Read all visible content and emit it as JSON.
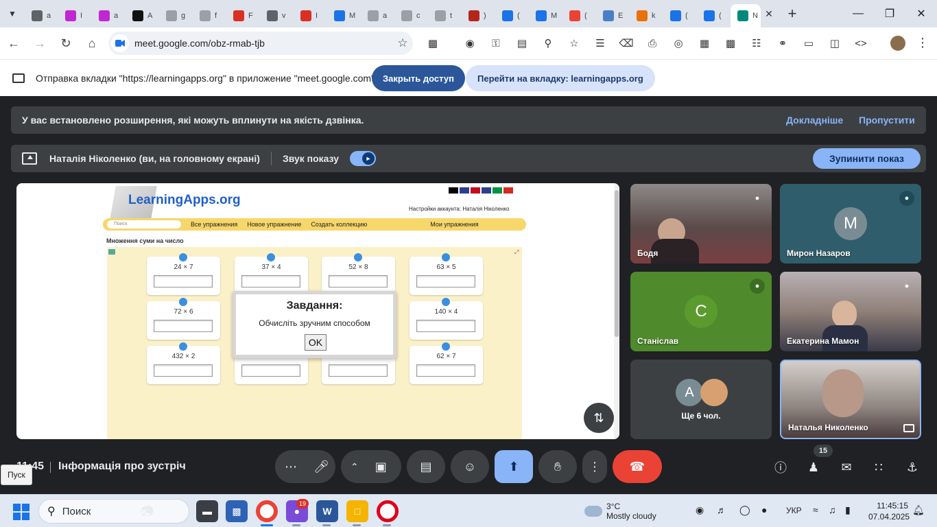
{
  "browser": {
    "tabs": [
      {
        "title": "a",
        "color": "#5f6368"
      },
      {
        "title": "I",
        "color": "#c026d3"
      },
      {
        "title": "a",
        "color": "#c026d3"
      },
      {
        "title": "A",
        "color": "#111111"
      },
      {
        "title": "g",
        "color": "#9aa0a6"
      },
      {
        "title": "f",
        "color": "#9aa0a6"
      },
      {
        "title": "F",
        "color": "#d93025"
      },
      {
        "title": "v",
        "color": "#5f6368"
      },
      {
        "title": "I",
        "color": "#d93025"
      },
      {
        "title": "M",
        "color": "#1a73e8"
      },
      {
        "title": "a",
        "color": "#9aa0a6"
      },
      {
        "title": "c",
        "color": "#9aa0a6"
      },
      {
        "title": "t",
        "color": "#9aa0a6"
      },
      {
        "title": ")",
        "color": "#b3261e"
      },
      {
        "title": "(",
        "color": "#1a73e8"
      },
      {
        "title": "M",
        "color": "#1a73e8"
      },
      {
        "title": "(",
        "color": "#ea4335"
      },
      {
        "title": "E",
        "color": "#4a7fc7"
      },
      {
        "title": "k",
        "color": "#e8710a"
      },
      {
        "title": "(",
        "color": "#1a73e8"
      },
      {
        "title": "(",
        "color": "#1a73e8"
      },
      {
        "title": "N",
        "color": "#00897b"
      }
    ],
    "url": "meet.google.com/obz-rmab-tjb"
  },
  "sharebar": {
    "text": "Отправка вкладки \"https://learningapps.org\" в приложение \"meet.google.com\"...",
    "stop_access": "Закрыть доступ",
    "goto_tab": "Перейти на вкладку: learningapps.org"
  },
  "warning": {
    "text": "У вас встановлено розширення, які можуть вплинути на якість дзвінка.",
    "details": "Докладніше",
    "skip": "Пропустити"
  },
  "presenting": {
    "text": "Наталія Ніколенко (ви, на головному екрані)",
    "sound_label": "Звук показу",
    "sound_on": true,
    "stop": "Зупинити показ"
  },
  "learningapps": {
    "logo": "LearningApps.org",
    "account": "Настройки аккаунта: Наталія Ніколенко",
    "search_placeholder": "Поиск",
    "nav": [
      "Все упражнения",
      "Новое упражнение",
      "Создать коллекцию",
      "Мои упражнения"
    ],
    "exercise_title": "Множення суми на число",
    "cards": [
      "24 × 7",
      "37 × 4",
      "52 × 8",
      "63 × 5",
      "72 × 6",
      "140 × 4",
      "432 × 2",
      "62 × 7"
    ],
    "dialog": {
      "title": "Завдання:",
      "message": "Обчисліть зручним способом",
      "ok": "OK"
    },
    "lang_flag_colors": [
      "#000000",
      "#2a3f8f",
      "#c60b1e",
      "#2a3f8f",
      "#009246",
      "#d52b1e"
    ]
  },
  "participants": [
    {
      "name": "Бодя",
      "muted": true,
      "bg": "#6b5a55"
    },
    {
      "name": "Мирон Назаров",
      "muted": true,
      "initial": "M",
      "bg": "#2f5d6b",
      "avatar": "#7a8c93"
    },
    {
      "name": "Станіслав",
      "muted": true,
      "initial": "C",
      "bg": "#4f8a2c",
      "avatar": "#5b9b2e"
    },
    {
      "name": "Екатерина Мамон",
      "muted": true,
      "bg": "#7a6355"
    },
    {
      "name": "Ще 6 чол.",
      "initial": "A",
      "bg": "#3c4043",
      "avatar": "#7a8c93"
    },
    {
      "name": "Наталья Николенко",
      "bg": "#8a7d7a"
    }
  ],
  "controls": {
    "time": "11:45",
    "meeting_info": "Інформація про зустріч",
    "participants_count": "15"
  },
  "tooltip": "Пуск",
  "taskbar": {
    "search": "Поиск",
    "chat_badge": "19",
    "weather_temp": "3°C",
    "weather_desc": "Mostly cloudy",
    "lang": "УКР",
    "time": "11:45:15",
    "date": "07.04.2025"
  }
}
